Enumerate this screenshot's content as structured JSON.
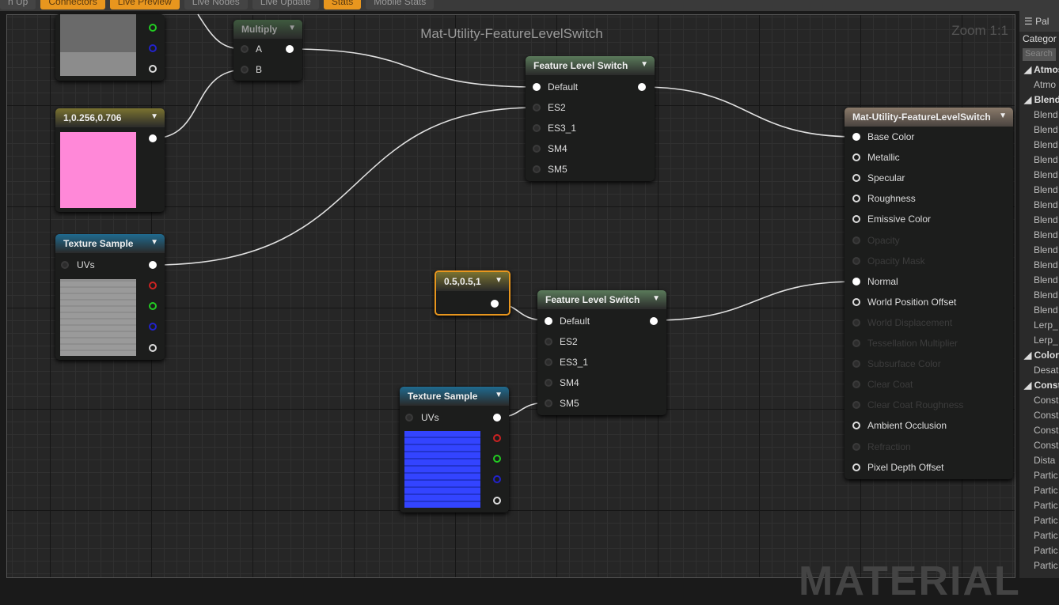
{
  "toolbar": {
    "tabs": [
      {
        "label": "n Up",
        "on": false
      },
      {
        "label": "Connectors",
        "on": true
      },
      {
        "label": "Live Preview",
        "on": true
      },
      {
        "label": "Live Nodes",
        "on": false
      },
      {
        "label": "Live Update",
        "on": false
      },
      {
        "label": "Stats",
        "on": true
      },
      {
        "label": "Mobile Stats",
        "on": false
      }
    ]
  },
  "graph": {
    "title": "Mat-Utility-FeatureLevelSwitch",
    "zoom": "Zoom 1:1",
    "watermark": "MATERIAL"
  },
  "nodes": {
    "multiply": {
      "title": "Multiply",
      "inputs": [
        "A",
        "B"
      ]
    },
    "constant_color": {
      "title": "1,0.256,0.706",
      "color": "#ff88d8"
    },
    "texture1": {
      "title": "Texture Sample",
      "input": "UVs"
    },
    "fls1": {
      "title": "Feature Level Switch",
      "inputs": [
        "Default",
        "ES2",
        "ES3_1",
        "SM4",
        "SM5"
      ]
    },
    "constant_normal": {
      "title": "0.5,0.5,1"
    },
    "fls2": {
      "title": "Feature Level Switch",
      "inputs": [
        "Default",
        "ES2",
        "ES3_1",
        "SM4",
        "SM5"
      ]
    },
    "texture2": {
      "title": "Texture Sample",
      "input": "UVs"
    },
    "material": {
      "title": "Mat-Utility-FeatureLevelSwitch",
      "inputs": [
        {
          "label": "Base Color",
          "state": "connected"
        },
        {
          "label": "Metallic",
          "state": "on"
        },
        {
          "label": "Specular",
          "state": "on"
        },
        {
          "label": "Roughness",
          "state": "on"
        },
        {
          "label": "Emissive Color",
          "state": "on"
        },
        {
          "label": "Opacity",
          "state": "disabled"
        },
        {
          "label": "Opacity Mask",
          "state": "disabled"
        },
        {
          "label": "Normal",
          "state": "connected"
        },
        {
          "label": "World Position Offset",
          "state": "on"
        },
        {
          "label": "World Displacement",
          "state": "disabled"
        },
        {
          "label": "Tessellation Multiplier",
          "state": "disabled"
        },
        {
          "label": "Subsurface Color",
          "state": "disabled"
        },
        {
          "label": "Clear Coat",
          "state": "disabled"
        },
        {
          "label": "Clear Coat Roughness",
          "state": "disabled"
        },
        {
          "label": "Ambient Occlusion",
          "state": "on"
        },
        {
          "label": "Refraction",
          "state": "disabled"
        },
        {
          "label": "Pixel Depth Offset",
          "state": "on"
        }
      ]
    }
  },
  "palette": {
    "tab": "Pal",
    "category_label": "Categor",
    "search_placeholder": "Search",
    "rows": [
      {
        "t": "◢ Atmos",
        "cat": true
      },
      {
        "t": "Atmo"
      },
      {
        "t": "◢ Blends",
        "cat": true
      },
      {
        "t": "Blend"
      },
      {
        "t": "Blend"
      },
      {
        "t": "Blend"
      },
      {
        "t": "Blend"
      },
      {
        "t": "Blend"
      },
      {
        "t": "Blend"
      },
      {
        "t": "Blend"
      },
      {
        "t": "Blend"
      },
      {
        "t": "Blend"
      },
      {
        "t": "Blend"
      },
      {
        "t": "Blend"
      },
      {
        "t": "Blend"
      },
      {
        "t": "Blend"
      },
      {
        "t": "Blend"
      },
      {
        "t": "Lerp_"
      },
      {
        "t": "Lerp_"
      },
      {
        "t": "◢ Color",
        "cat": true
      },
      {
        "t": "Desat"
      },
      {
        "t": "◢ Consta",
        "cat": true
      },
      {
        "t": "Const"
      },
      {
        "t": "Const"
      },
      {
        "t": "Const"
      },
      {
        "t": "Const"
      },
      {
        "t": "Dista"
      },
      {
        "t": "Partic"
      },
      {
        "t": "Partic"
      },
      {
        "t": "Partic"
      },
      {
        "t": "Partic"
      },
      {
        "t": "Partic"
      },
      {
        "t": "Partic"
      },
      {
        "t": "Partic"
      }
    ]
  },
  "colors": {
    "accent": "#e8961e",
    "texture_header": "#1f5f7f",
    "switch_header": "#4f6f4f",
    "constant_header": "#6f6a2a",
    "selection": "#e8961e"
  }
}
